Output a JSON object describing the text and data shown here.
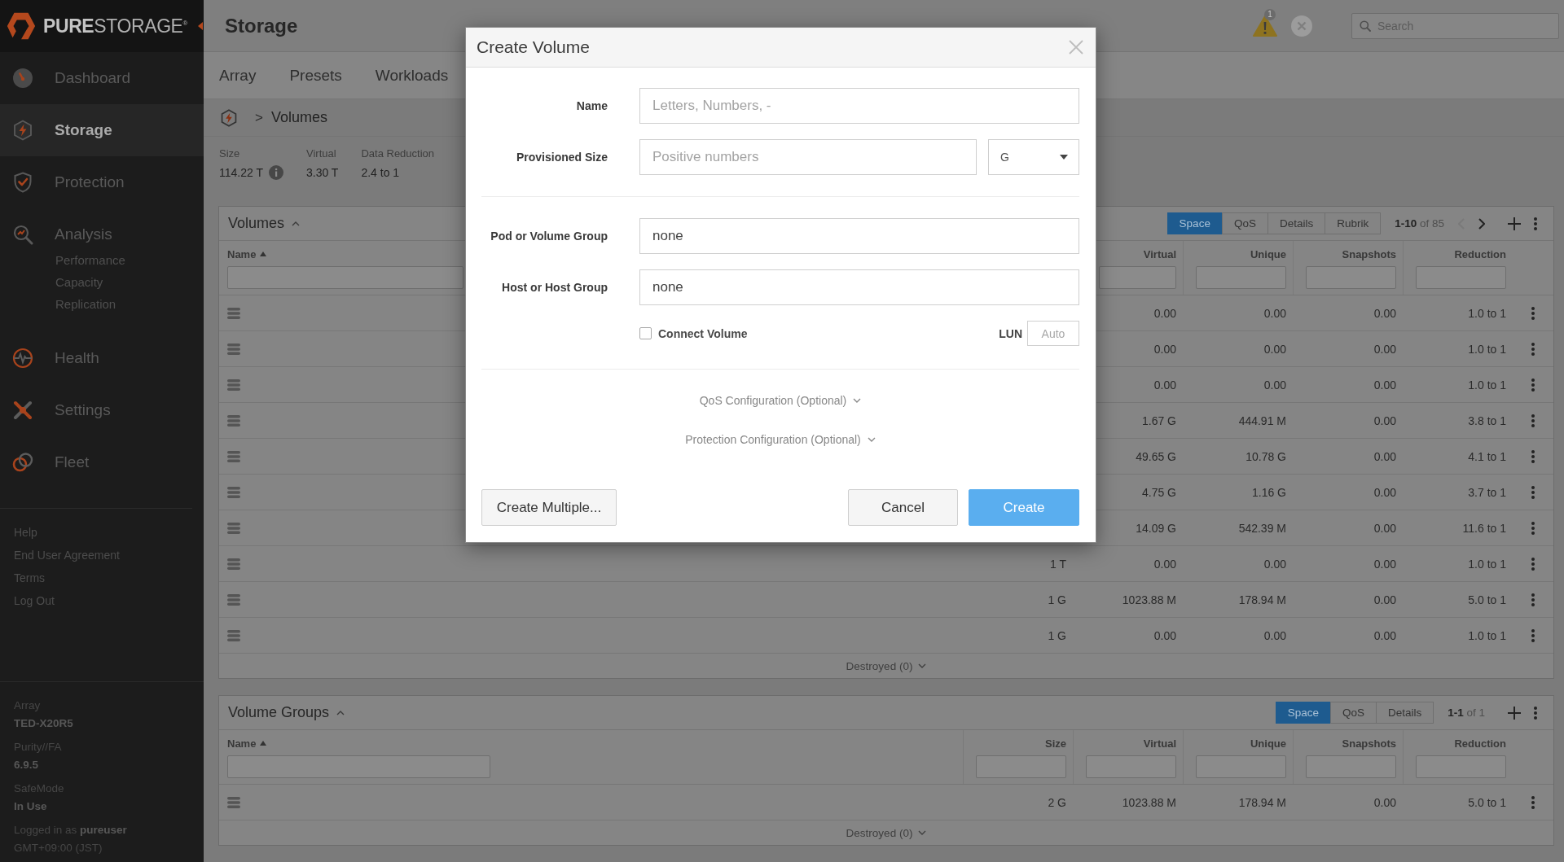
{
  "sidebar": {
    "logo": "**PURE**STORAGE$^{®}$",
    "nav": [
      {
        "label": "Dashboard",
        "selected": false
      },
      {
        "label": "Storage",
        "selected": true
      },
      {
        "label": "Protection",
        "selected": false
      },
      {
        "label": "Analysis",
        "selected": false,
        "children": [
          {
            "label": "Performance",
            "selected": false
          },
          {
            "label": "Capacity",
            "selected": false
          },
          {
            "label": "Replication",
            "selected": false
          }
        ]
      },
      {
        "label": "Health",
        "selected": false
      },
      {
        "label": "Settings",
        "selected": false
      },
      {
        "label": "Fleet",
        "selected": false
      }
    ],
    "links": [
      "Help",
      "End User Agreement",
      "Terms",
      "Log Out"
    ],
    "array_info": [
      {
        "label": "Array",
        "value": "TED-X20R5"
      },
      {
        "label": "Purity//FA",
        "value": "6.9.5"
      },
      {
        "label": "SafeMode",
        "value": "In Use"
      }
    ],
    "session": {
      "user": "Logged in as **pureuser**",
      "timezone": "GMT+09:00 (JST)"
    }
  },
  "header": {
    "title": "Storage",
    "alert_count": "1",
    "search": {
      "placeholder": "Search"
    }
  },
  "tabs": [
    {
      "label": "Array",
      "selected": false
    },
    {
      "label": "Presets",
      "selected": false
    },
    {
      "label": "Workloads",
      "selected": false
    }
  ],
  "breadcrumb": {
    "separator": ">",
    "current": "Volumes"
  },
  "stats": [
    {
      "label": "Size",
      "value": "114.22 T",
      "info": true
    },
    {
      "label": "Virtual",
      "value": "3.30 T",
      "info": false
    },
    {
      "label": "Data Reduction",
      "value": "2.4 to 1",
      "info": false
    }
  ],
  "volumes": {
    "title": "Volumes",
    "expanded": true,
    "views": [
      {
        "label": "Space",
        "selected": true
      },
      {
        "label": "QoS",
        "selected": false
      },
      {
        "label": "Details",
        "selected": false
      },
      {
        "label": "Rubrik",
        "selected": false
      }
    ],
    "pager": {
      "range": "**1-10** of 85",
      "arrows": [
        {
          "kind": "prev",
          "disabled": true
        },
        {
          "kind": "next",
          "disabled": false
        }
      ]
    },
    "columns": [
      {
        "label": "Name",
        "sorted": true
      },
      {},
      {
        "label": "Virtual",
        "sorted": false
      },
      {
        "label": "Unique",
        "sorted": false
      },
      {
        "label": "Snapshots",
        "sorted": false
      },
      {
        "label": "Reduction",
        "sorted": false
      }
    ],
    "rows": [
      [
        "",
        "",
        "0.00",
        "0.00",
        "0.00",
        "1.0 to 1"
      ],
      [
        "",
        "",
        "0.00",
        "0.00",
        "0.00",
        "1.0 to 1"
      ],
      [
        "",
        "",
        "0.00",
        "0.00",
        "0.00",
        "1.0 to 1"
      ],
      [
        "",
        "",
        "1.67 G",
        "444.91 M",
        "0.00",
        "3.8 to 1"
      ],
      [
        "",
        "",
        "49.65 G",
        "10.78 G",
        "0.00",
        "4.1 to 1"
      ],
      [
        "",
        "",
        "4.75 G",
        "1.16 G",
        "0.00",
        "3.7 to 1"
      ],
      [
        "",
        "",
        "14.09 G",
        "542.39 M",
        "0.00",
        "11.6 to 1"
      ],
      [
        "",
        "1 T",
        "0.00",
        "0.00",
        "0.00",
        "1.0 to 1"
      ],
      [
        "",
        "1 G",
        "1023.88 M",
        "178.94 M",
        "0.00",
        "5.0 to 1"
      ],
      [
        "",
        "1 G",
        "0.00",
        "0.00",
        "0.00",
        "1.0 to 1"
      ]
    ],
    "destroyed": {
      "label": "Destroyed (0)",
      "expanded": false
    }
  },
  "volume_groups": {
    "title": "Volume Groups",
    "expanded": true,
    "views": [
      {
        "label": "Space",
        "selected": true
      },
      {
        "label": "QoS",
        "selected": false
      },
      {
        "label": "Details",
        "selected": false
      }
    ],
    "pager": {
      "range": "**1-1** of 1"
    },
    "columns": [
      {
        "label": "Name",
        "sorted": true
      },
      {
        "label": "Size",
        "sorted": false
      },
      {
        "label": "Virtual",
        "sorted": false
      },
      {
        "label": "Unique",
        "sorted": false
      },
      {
        "label": "Snapshots",
        "sorted": false
      },
      {
        "label": "Reduction",
        "sorted": false
      }
    ],
    "rows": [
      [
        "",
        "2 G",
        "1023.88 M",
        "178.94 M",
        "0.00",
        "5.0 to 1"
      ]
    ],
    "destroyed": {
      "label": "Destroyed (0)",
      "expanded": false
    }
  },
  "dialog": {
    "title": "Create Volume",
    "name_field": {
      "label": "Name",
      "placeholder": "Letters, Numbers, -"
    },
    "size_field": {
      "label": "Provisioned Size",
      "placeholder": "Positive numbers",
      "unit": "G"
    },
    "placement_fields": [
      {
        "label": "Pod or Volume Group",
        "value": "none"
      },
      {
        "label": "Host or Host Group",
        "value": "none"
      }
    ],
    "connect": {
      "label": "Connect Volume",
      "checked": false,
      "lun_label": "LUN",
      "lun_placeholder": "Auto"
    },
    "sections": [
      {
        "label": "QoS Configuration (Optional)",
        "expanded": false
      },
      {
        "label": "Protection Configuration (Optional)",
        "expanded": false
      }
    ],
    "buttons": [
      {
        "label": "Create Multiple...",
        "kind": "secondary"
      },
      {
        "label": "Cancel",
        "kind": "secondary"
      },
      {
        "label": "Create",
        "kind": "primary"
      }
    ]
  }
}
